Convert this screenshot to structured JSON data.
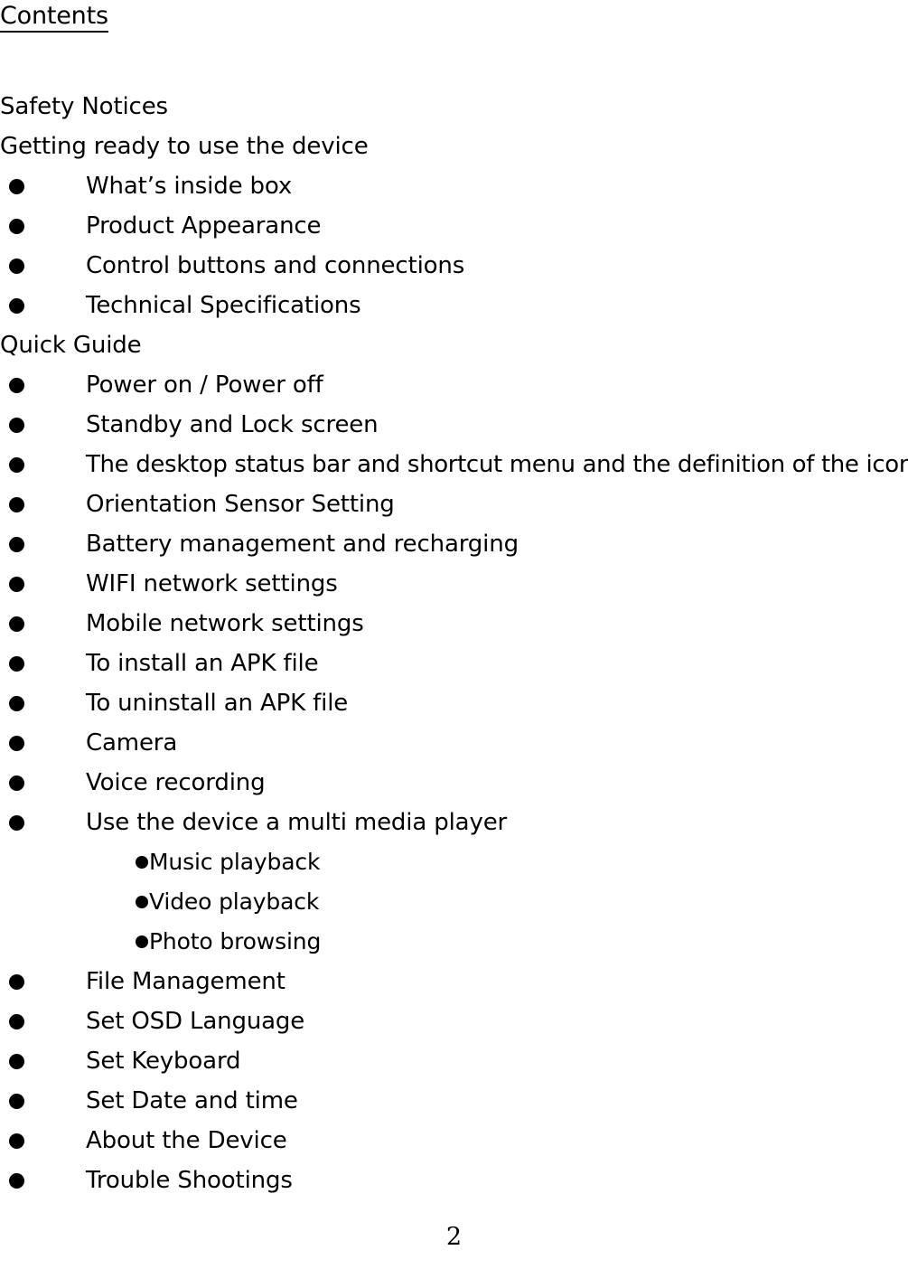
{
  "document": {
    "heading": "Contents",
    "page_number": "2"
  },
  "toc": {
    "entries": [
      {
        "level": "section",
        "label": "Safety Notices"
      },
      {
        "level": "section",
        "label": "Getting ready to use the device"
      },
      {
        "level": "item",
        "label": "What’s inside box"
      },
      {
        "level": "item",
        "label": "Product Appearance"
      },
      {
        "level": "item",
        "label": "Control buttons and connections"
      },
      {
        "level": "item",
        "label": "Technical Specifications"
      },
      {
        "level": "section",
        "label": "Quick Guide"
      },
      {
        "level": "item",
        "label": "Power on / Power off"
      },
      {
        "level": "item",
        "label": "Standby and Lock screen"
      },
      {
        "level": "item",
        "wide": true,
        "label": "The desktop status bar and shortcut menu and the definition of the icons"
      },
      {
        "level": "item",
        "label": "Orientation Sensor Setting"
      },
      {
        "level": "item",
        "label": "Battery management and recharging"
      },
      {
        "level": "item",
        "label": "WIFI network settings"
      },
      {
        "level": "item",
        "label": "Mobile network settings"
      },
      {
        "level": "item",
        "label": "To install an APK file"
      },
      {
        "level": "item",
        "label": "To uninstall an APK file"
      },
      {
        "level": "item",
        "label": "Camera"
      },
      {
        "level": "item",
        "label": "Voice recording"
      },
      {
        "level": "item",
        "label": "Use the device a multi media player"
      },
      {
        "level": "subitem",
        "label": "Music playback"
      },
      {
        "level": "subitem",
        "label": "Video playback"
      },
      {
        "level": "subitem",
        "label": "Photo browsing"
      },
      {
        "level": "item",
        "label": "File Management"
      },
      {
        "level": "item",
        "label": "Set OSD Language"
      },
      {
        "level": "item",
        "label": "Set Keyboard"
      },
      {
        "level": "item",
        "label": "Set Date and time"
      },
      {
        "level": "item",
        "label": "About the Device"
      },
      {
        "level": "item",
        "label": "Trouble Shootings"
      }
    ]
  }
}
